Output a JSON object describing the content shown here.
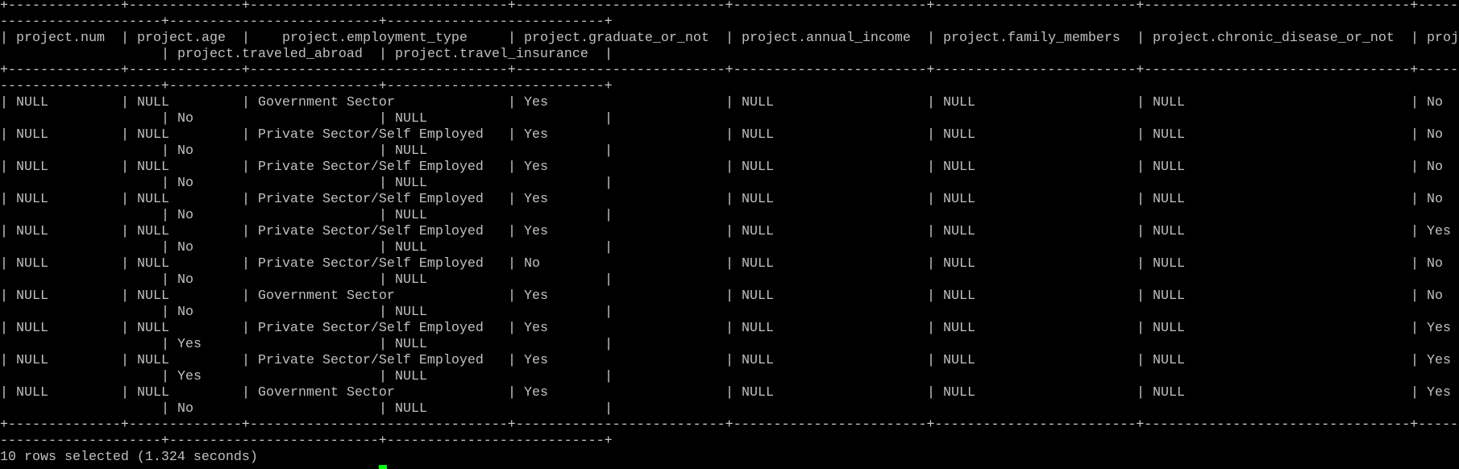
{
  "terminal": {
    "status_line": "10 rows selected (1.324 seconds)",
    "cursor_color": "#00ff00",
    "text_color": "#c0c0c0"
  },
  "table": {
    "columns": [
      {
        "header": "project.num"
      },
      {
        "header": "project.age"
      },
      {
        "header": "project.employment_type"
      },
      {
        "header": "project.graduate_or_not"
      },
      {
        "header": "project.annual_income"
      },
      {
        "header": "project.family_members"
      },
      {
        "header": "project.chronic_disease_or_not"
      },
      {
        "header": "project.frequent_flyer"
      },
      {
        "header": "project.traveled_abroad"
      },
      {
        "header": "project.travel_insurance"
      }
    ],
    "rows": [
      [
        "NULL",
        "NULL",
        "Government Sector",
        "Yes",
        "NULL",
        "NULL",
        "NULL",
        "No",
        "No",
        "NULL"
      ],
      [
        "NULL",
        "NULL",
        "Private Sector/Self Employed",
        "Yes",
        "NULL",
        "NULL",
        "NULL",
        "No",
        "No",
        "NULL"
      ],
      [
        "NULL",
        "NULL",
        "Private Sector/Self Employed",
        "Yes",
        "NULL",
        "NULL",
        "NULL",
        "No",
        "No",
        "NULL"
      ],
      [
        "NULL",
        "NULL",
        "Private Sector/Self Employed",
        "Yes",
        "NULL",
        "NULL",
        "NULL",
        "No",
        "No",
        "NULL"
      ],
      [
        "NULL",
        "NULL",
        "Private Sector/Self Employed",
        "Yes",
        "NULL",
        "NULL",
        "NULL",
        "Yes",
        "No",
        "NULL"
      ],
      [
        "NULL",
        "NULL",
        "Private Sector/Self Employed",
        "No",
        "NULL",
        "NULL",
        "NULL",
        "No",
        "No",
        "NULL"
      ],
      [
        "NULL",
        "NULL",
        "Government Sector",
        "Yes",
        "NULL",
        "NULL",
        "NULL",
        "No",
        "No",
        "NULL"
      ],
      [
        "NULL",
        "NULL",
        "Private Sector/Self Employed",
        "Yes",
        "NULL",
        "NULL",
        "NULL",
        "Yes",
        "Yes",
        "NULL"
      ],
      [
        "NULL",
        "NULL",
        "Private Sector/Self Employed",
        "Yes",
        "NULL",
        "NULL",
        "NULL",
        "Yes",
        "Yes",
        "NULL"
      ],
      [
        "NULL",
        "NULL",
        "Government Sector",
        "Yes",
        "NULL",
        "NULL",
        "NULL",
        "Yes",
        "No",
        "NULL"
      ]
    ]
  }
}
